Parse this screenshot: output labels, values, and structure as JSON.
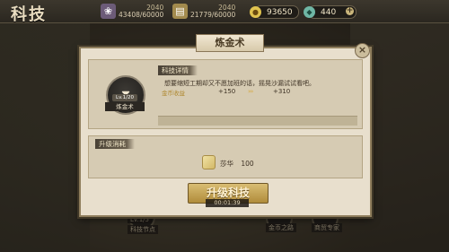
{
  "header": {
    "title": "科技"
  },
  "resources": [
    {
      "icon": "food-icon",
      "top": "2040",
      "bottom": "43408/60000"
    },
    {
      "icon": "wood-icon",
      "top": "2040",
      "bottom": "21779/60000"
    }
  ],
  "currencies": [
    {
      "icon": "coin-icon",
      "value": "93650"
    },
    {
      "icon": "gem-icon",
      "value": "440"
    }
  ],
  "dialog": {
    "title": "炼金术",
    "close_symbol": "×",
    "detail_section": "科技详情",
    "tech_level": "Lv.1/20",
    "tech_name": "炼金术",
    "description": "想要缩短工期却又不愿加班的话，摇晃沙漏试试看吧。",
    "attribute_label": "金币收益",
    "current_value": "+150",
    "arrow_glyph": "›››",
    "next_value": "+310",
    "cost_section": "升级消耗",
    "cost_item": "莎华",
    "cost_amount": "100",
    "upgrade_button": "升级科技",
    "upgrade_time": "00:01:39"
  },
  "background": {
    "nodes": [
      {
        "level": "Lv.1/5",
        "label": "科技节点"
      },
      {
        "level": "",
        "label": "金币之路"
      },
      {
        "level": "",
        "label": "商贸专家"
      }
    ]
  }
}
